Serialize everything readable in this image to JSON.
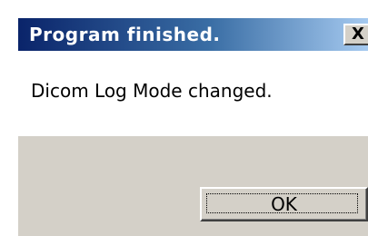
{
  "dialog": {
    "title": "Program finished.",
    "close_symbol": "X",
    "message": "Dicom Log Mode changed.",
    "ok_label": "OK"
  },
  "colors": {
    "title_bar_start": "#0a246a",
    "title_bar_end": "#a6caf0",
    "dialog_face": "#d4d0c8",
    "message_background": "#ffffff"
  },
  "icons": {
    "close": "close-icon"
  }
}
